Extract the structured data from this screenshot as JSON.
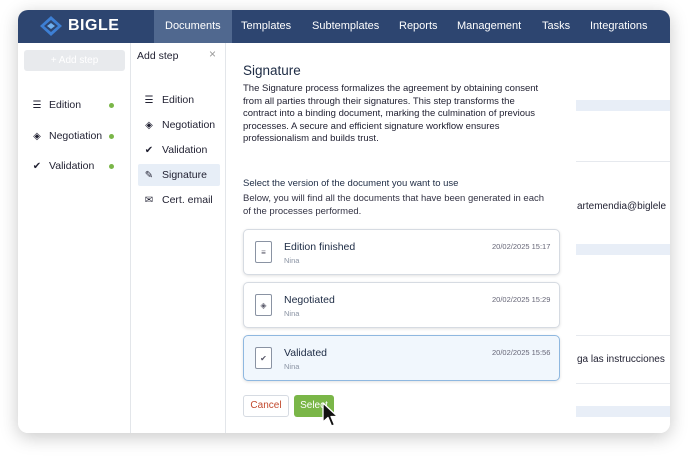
{
  "app": {
    "logo_text": "BIGLE"
  },
  "nav": {
    "items": [
      {
        "label": "Documents",
        "active": true
      },
      {
        "label": "Templates"
      },
      {
        "label": "Subtemplates"
      },
      {
        "label": "Reports"
      },
      {
        "label": "Management"
      },
      {
        "label": "Tasks"
      },
      {
        "label": "Integrations"
      }
    ]
  },
  "left": {
    "add_step_label": "+ Add step",
    "items": [
      {
        "label": "Edition",
        "icon": "edit-lines-icon"
      },
      {
        "label": "Negotiation",
        "icon": "handshake-icon"
      },
      {
        "label": "Validation",
        "icon": "check-circle-icon"
      }
    ],
    "status_color": "#7ab648"
  },
  "add_step_panel": {
    "title": "Add step",
    "items": [
      {
        "label": "Edition",
        "icon": "edit-lines-icon"
      },
      {
        "label": "Negotiation",
        "icon": "handshake-icon"
      },
      {
        "label": "Validation",
        "icon": "check-circle-icon"
      },
      {
        "label": "Signature",
        "icon": "signature-icon",
        "active": true
      },
      {
        "label": "Cert. email",
        "icon": "email-icon"
      }
    ]
  },
  "signature": {
    "title": "Signature",
    "description": "The Signature process formalizes the agreement by obtaining consent from all parties through their signatures. This step transforms the contract into a binding document, marking the culmination of previous processes. A secure and efficient signature workflow ensures professionalism and builds trust.",
    "select_heading": "Select the version of the document you want to use",
    "select_help": "Below, you will find all the documents that have been generated in each of the processes performed.",
    "documents": [
      {
        "name": "Edition finished",
        "user": "Nina",
        "date": "20/02/2025 15:17",
        "icon": "document-edit-icon"
      },
      {
        "name": "Negotiated",
        "user": "Nina",
        "date": "20/02/2025 15:29",
        "icon": "document-handshake-icon"
      },
      {
        "name": "Validated",
        "user": "Nina",
        "date": "20/02/2025 15:56",
        "icon": "document-check-icon",
        "selected": true
      }
    ],
    "cancel_label": "Cancel",
    "select_label": "Select"
  },
  "background": {
    "email_snippet": "artemendia@biglele",
    "instructions_snippet": "ga las instrucciones"
  },
  "colors": {
    "nav_bg": "#2d4570",
    "nav_active": "#50688f",
    "accent_green": "#7ab648",
    "cancel_red": "#c24a2e"
  }
}
